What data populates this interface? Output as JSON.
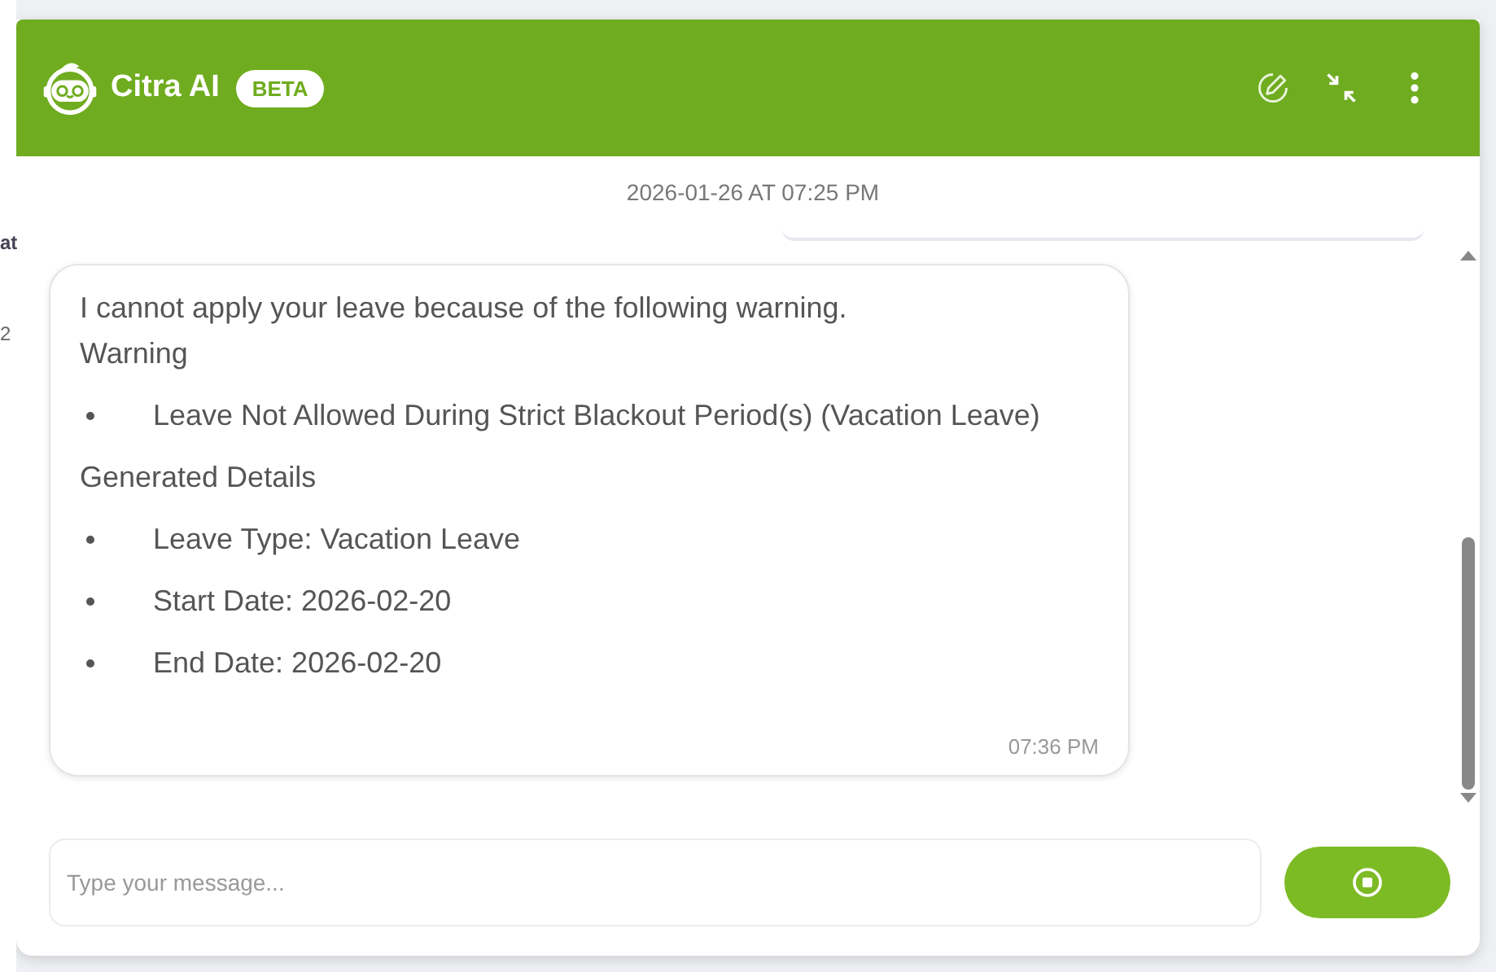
{
  "background": {
    "texts": [
      "at",
      "2"
    ]
  },
  "header": {
    "title": "Citra AI",
    "badge": "BETA"
  },
  "chat": {
    "date": "2026-01-26 AT 07:25 PM",
    "messages": [
      {
        "time": "07:36 PM",
        "lines": [
          {
            "kind": "text",
            "text": "I cannot apply your leave because of the following warning."
          },
          {
            "kind": "text",
            "text": "Warning"
          },
          {
            "kind": "bullet",
            "text": "Leave Not Allowed During Strict Blackout Period(s) (Vacation Leave)"
          },
          {
            "kind": "text",
            "text": "Generated Details"
          },
          {
            "kind": "bullet",
            "text": "Leave Type: Vacation Leave"
          },
          {
            "kind": "bullet",
            "text": "Start Date: 2026-02-20"
          },
          {
            "kind": "bullet",
            "text": "End Date: 2026-02-20"
          }
        ]
      }
    ]
  },
  "composer": {
    "placeholder": "Type your message..."
  }
}
